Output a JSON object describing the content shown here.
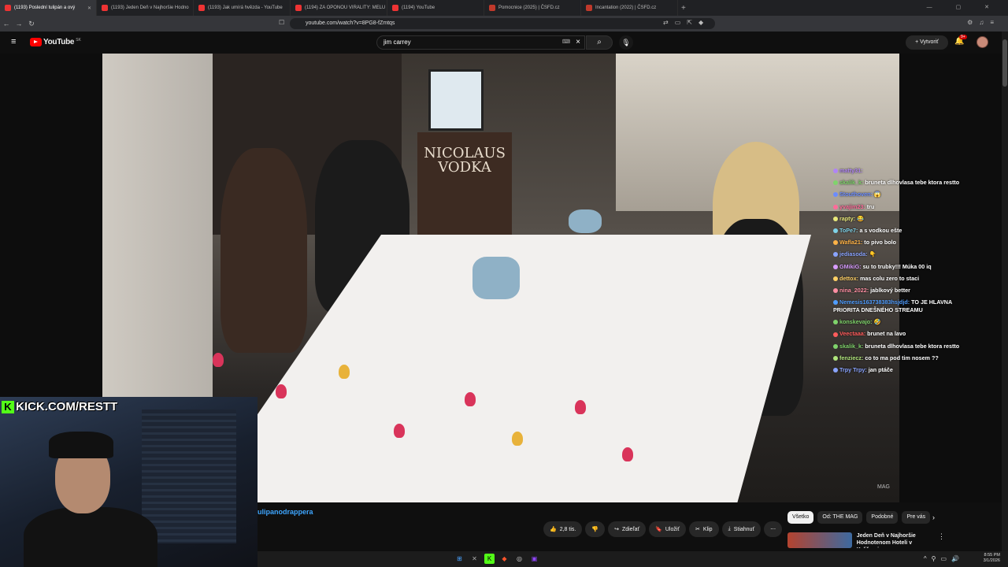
{
  "browser": {
    "tabs": [
      {
        "title": "(1193) Poslední tulipán a ový",
        "active": true
      },
      {
        "title": "(1193) Jeden Deň v Najhoršie Hodno",
        "active": false
      },
      {
        "title": "(1193) Jak umírá hvězda - YouTube",
        "active": false
      },
      {
        "title": "(1194) ZA OPONOU VIRALITY: MELU",
        "active": false
      },
      {
        "title": "(1194) YouTube",
        "active": false
      },
      {
        "title": "Pomocnice (2025) | ČSFD.cz",
        "active": false
      },
      {
        "title": "Incantation (2022) | ČSFD.cz",
        "active": false
      }
    ],
    "new_tab": "+",
    "tab_close": "✕",
    "url": "youtube.com/watch?v=8PG8-fZmtqs"
  },
  "youtube": {
    "logo_text": "YouTube",
    "region": "SK",
    "search_value": "jim carrey",
    "create_label": "Vytvoriť",
    "notif_count": "9+"
  },
  "chat": [
    {
      "user": "matty31:",
      "text": "",
      "color": "#b084f5"
    },
    {
      "user": "skalik_k:",
      "text": "bruneta dlhovlasa tebe ktora restto",
      "color": "#7fd36b"
    },
    {
      "user": "Stouthoven:",
      "text": "😱",
      "color": "#6b8cff"
    },
    {
      "user": "yvajim23:",
      "text": "tru",
      "color": "#ff6b9a"
    },
    {
      "user": "rapty:",
      "text": "😂",
      "color": "#e8e87a"
    },
    {
      "user": "ToPe7:",
      "text": "a s vodkou ešte",
      "color": "#7fd3e8"
    },
    {
      "user": "Wafla21:",
      "text": "to pivo bolo",
      "color": "#ffb347"
    },
    {
      "user": "jediasoda:",
      "text": "👇",
      "color": "#8aa4ff"
    },
    {
      "user": "GMikiG:",
      "text": "su to trubky!!! Múka 00 iq",
      "color": "#d89cff"
    },
    {
      "user": "dettox:",
      "text": "mas colu zero to staci",
      "color": "#ffd166"
    },
    {
      "user": "nina_2022:",
      "text": "jablkový better",
      "color": "#ff8fa3"
    },
    {
      "user": "Nemesis163738383hsjdjd:",
      "text": "TO JE HLAVNA PRIORITA DNEŠNÉHO STREAMU",
      "color": "#4f9dff"
    },
    {
      "user": "konskevajo:",
      "text": "🤣",
      "color": "#7fd36b"
    },
    {
      "user": "Veectaaa:",
      "text": "brunet na lavo",
      "color": "#ff5c5c"
    },
    {
      "user": "skalik_k:",
      "text": "bruneta dlhovlasa tebe ktora restto",
      "color": "#7fd36b"
    },
    {
      "user": "fenziecz:",
      "text": "co to ma pod tim nosem ??",
      "color": "#b0e57c"
    },
    {
      "user": "Trpy Trpy:",
      "text": "jan ptáče",
      "color": "#8aa4ff"
    }
  ],
  "video": {
    "sign_text": "NICOLAUS VODKA",
    "watermark": "MAG"
  },
  "overlay": {
    "kick_label": "KICK.COM/RESTT",
    "title_snippet": "ulipanodrappera"
  },
  "actions": {
    "like_count": "2,8 tis.",
    "share": "Zdieľať",
    "save": "Uložiť",
    "clip": "Klip",
    "download": "Stiahnuť",
    "more": "⋯"
  },
  "chips": [
    "Všetko",
    "Od: THE MAG",
    "Podobné",
    "Pre vás"
  ],
  "recommendation": {
    "title": "Jeden Deň v Najhoršie Hodnotenom Hoteli v Kaliforni..."
  },
  "clock": {
    "time": "8:55 PM",
    "date": "3/1/2026"
  },
  "colors": {
    "accent": "#ff0000",
    "kick": "#53fc18",
    "link": "#3ea6ff"
  }
}
